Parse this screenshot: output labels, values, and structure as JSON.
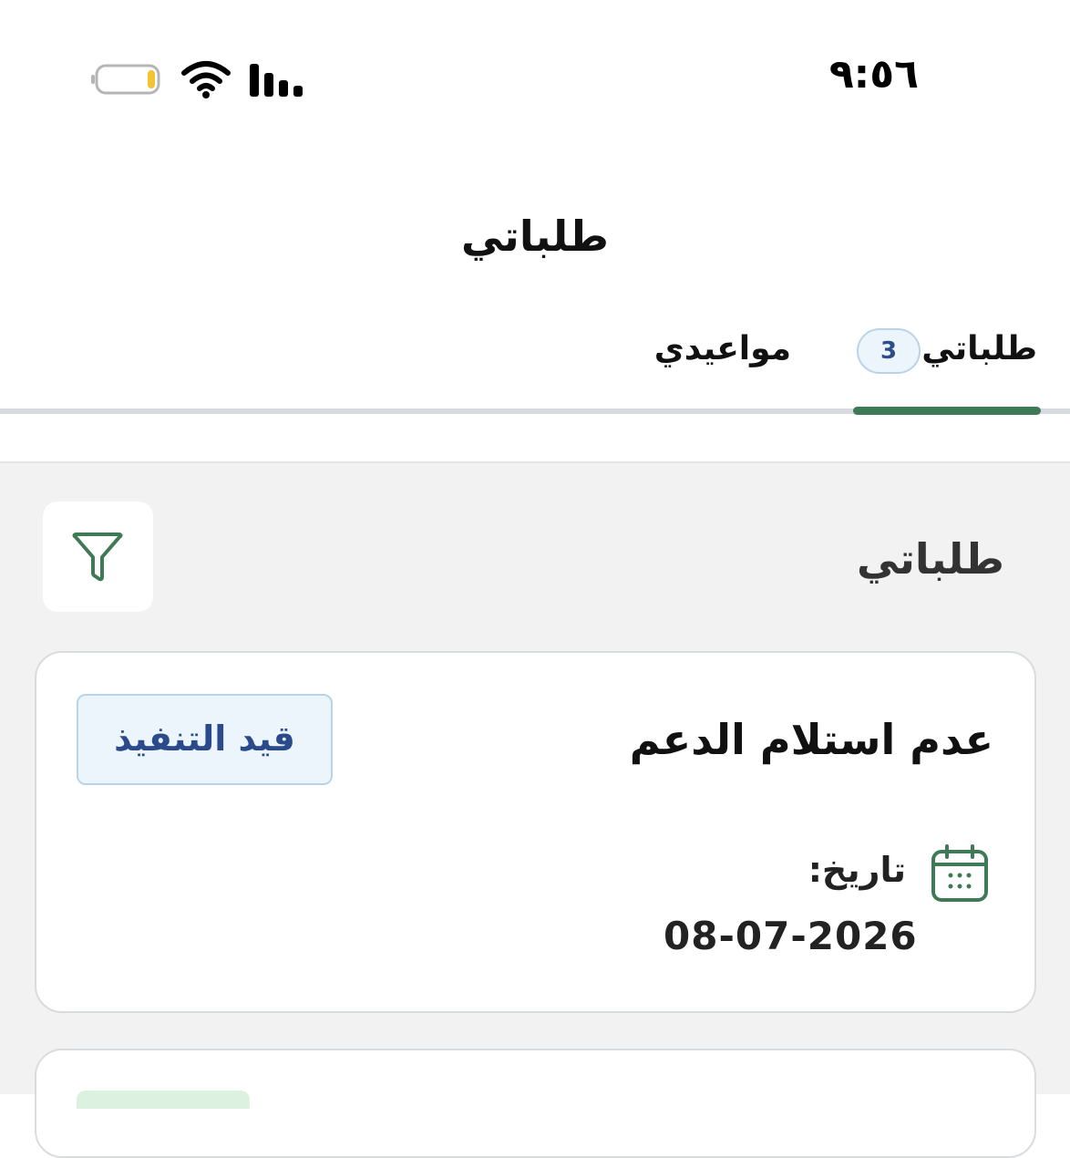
{
  "status_bar": {
    "time": "٩:٥٦",
    "battery_icon": "battery-low-icon",
    "wifi_icon": "wifi-icon",
    "signal_icon": "signal-bars-icon",
    "battery_color": "#f4c430"
  },
  "header": {
    "title": "طلباتي"
  },
  "tabs": [
    {
      "label": "طلباتي",
      "count": "3",
      "active": true
    },
    {
      "label": "مواعيدي",
      "active": false
    }
  ],
  "section": {
    "title": "طلباتي",
    "filter_icon": "filter-icon"
  },
  "requests": [
    {
      "title": "عدم استلام الدعم",
      "status": "قيد التنفيذ",
      "date_label": "تاريخ:",
      "date": "08-07-2026",
      "calendar_icon": "calendar-icon"
    }
  ],
  "colors": {
    "accent": "#3f7a56",
    "badge_bg": "#edf5fc",
    "badge_border": "#b9d3ea",
    "badge_text": "#2b4a8c",
    "content_bg": "#f2f2f2"
  }
}
